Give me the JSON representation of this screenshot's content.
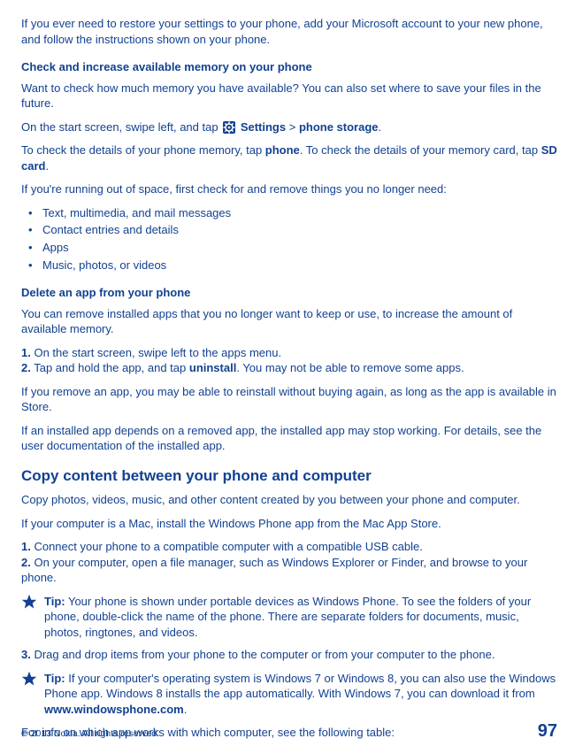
{
  "intro": "If you ever need to restore your settings to your phone, add your Microsoft account to your new phone, and follow the instructions shown on your phone.",
  "s1": {
    "title": "Check and increase available memory on your phone",
    "p1": "Want to check how much memory you have available? You can also set where to save your files in the future.",
    "p2a": "On the start screen, swipe left, and tap ",
    "p2_settings": "Settings",
    "p2_gt": " > ",
    "p2_storage": "phone storage",
    "p2_end": ".",
    "p3a": "To check the details of your phone memory, tap ",
    "p3_phone": "phone",
    "p3b": ". To check the details of your memory card, tap ",
    "p3_sd": "SD card",
    "p3_end": ".",
    "p4": "If you're running out of space, first check for and remove things you no longer need:",
    "li1": "Text, multimedia, and mail messages",
    "li2": "Contact entries and details",
    "li3": "Apps",
    "li4": "Music, photos, or videos"
  },
  "s2": {
    "title": "Delete an app from your phone",
    "p1": "You can remove installed apps that you no longer want to keep or use, to increase the amount of available memory.",
    "n1b": "1.",
    "n1": " On the start screen, swipe left to the apps menu.",
    "n2b": "2.",
    "n2a": " Tap and hold the app, and tap ",
    "n2u": "uninstall",
    "n2b2": ". You may not be able to remove some apps.",
    "p3": "If you remove an app, you may be able to reinstall without buying again, as long as the app is available in Store.",
    "p4": "If an installed app depends on a removed app, the installed app may stop working. For details, see the user documentation of the installed app."
  },
  "s3": {
    "title": "Copy content between your phone and computer",
    "p1": "Copy photos, videos, music, and other content created by you between your phone and computer.",
    "p2": "If your computer is a Mac, install the Windows Phone app from the Mac App Store.",
    "n1b": "1.",
    "n1": " Connect your phone to a compatible computer with a compatible USB cable.",
    "n2b": "2.",
    "n2": " On your computer, open a file manager, such as Windows Explorer or Finder, and browse to your phone.",
    "tip1_label": "Tip:",
    "tip1": " Your phone is shown under portable devices as Windows Phone. To see the folders of your phone, double-click the name of the phone. There are separate folders for documents, music, photos, ringtones, and videos.",
    "n3b": "3.",
    "n3": " Drag and drop items from your phone to the computer or from your computer to the phone.",
    "tip2_label": "Tip:",
    "tip2a": " If your computer's operating system is Windows 7 or Windows 8, you can also use the Windows Phone app. Windows 8 installs the app automatically. With Windows 7, you can download it from ",
    "tip2_url": "www.windowsphone.com",
    "tip2b": ".",
    "p_last": "For info on which app works with which computer, see the following table:"
  },
  "footer": {
    "copyright": "© 2013 Nokia. All rights reserved.",
    "page": "97"
  }
}
